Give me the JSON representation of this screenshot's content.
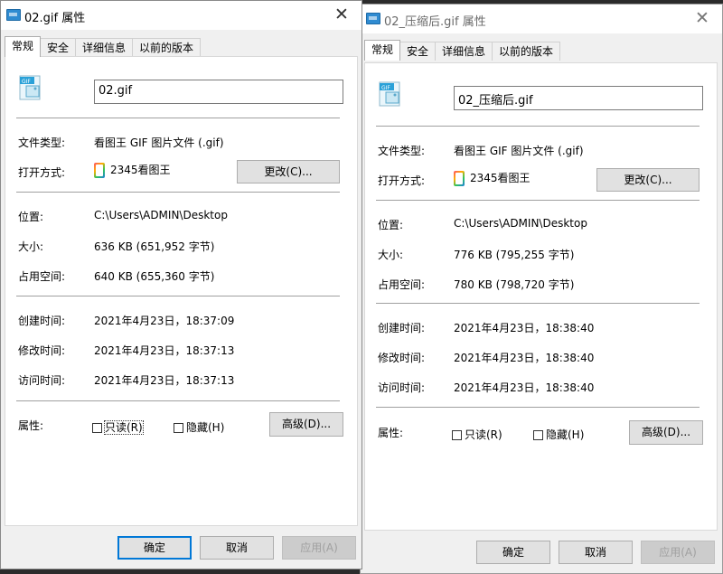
{
  "dialogs": [
    {
      "title": "02.gif 属性",
      "tabs": [
        "常规",
        "安全",
        "详细信息",
        "以前的版本"
      ],
      "filename": "02.gif",
      "file_type_label": "文件类型:",
      "file_type": "看图王 GIF 图片文件 (.gif)",
      "open_with_label": "打开方式:",
      "open_with": "2345看图王",
      "change_button": "更改(C)...",
      "location_label": "位置:",
      "location": "C:\\Users\\ADMIN\\Desktop",
      "size_label": "大小:",
      "size": "636 KB (651,952 字节)",
      "size_on_disk_label": "占用空间:",
      "size_on_disk": "640 KB (655,360 字节)",
      "created_label": "创建时间:",
      "created": "2021年4月23日，18:37:09",
      "modified_label": "修改时间:",
      "modified": "2021年4月23日，18:37:13",
      "accessed_label": "访问时间:",
      "accessed": "2021年4月23日，18:37:13",
      "attributes_label": "属性:",
      "readonly_label": "只读(R)",
      "hidden_label": "隐藏(H)",
      "advanced_button": "高级(D)...",
      "ok_button": "确定",
      "cancel_button": "取消",
      "apply_button": "应用(A)"
    },
    {
      "title": "02_压缩后.gif 属性",
      "tabs": [
        "常规",
        "安全",
        "详细信息",
        "以前的版本"
      ],
      "filename": "02_压缩后.gif",
      "file_type_label": "文件类型:",
      "file_type": "看图王 GIF 图片文件 (.gif)",
      "open_with_label": "打开方式:",
      "open_with": "2345看图王",
      "change_button": "更改(C)...",
      "location_label": "位置:",
      "location": "C:\\Users\\ADMIN\\Desktop",
      "size_label": "大小:",
      "size": "776 KB (795,255 字节)",
      "size_on_disk_label": "占用空间:",
      "size_on_disk": "780 KB (798,720 字节)",
      "created_label": "创建时间:",
      "created": "2021年4月23日，18:38:40",
      "modified_label": "修改时间:",
      "modified": "2021年4月23日，18:38:40",
      "accessed_label": "访问时间:",
      "accessed": "2021年4月23日，18:38:40",
      "attributes_label": "属性:",
      "readonly_label": "只读(R)",
      "hidden_label": "隐藏(H)",
      "advanced_button": "高级(D)...",
      "ok_button": "确定",
      "cancel_button": "取消",
      "apply_button": "应用(A)"
    }
  ],
  "icons": {
    "file": "gif-file-icon",
    "app": "2345-viewer-icon",
    "close": "close-icon"
  }
}
